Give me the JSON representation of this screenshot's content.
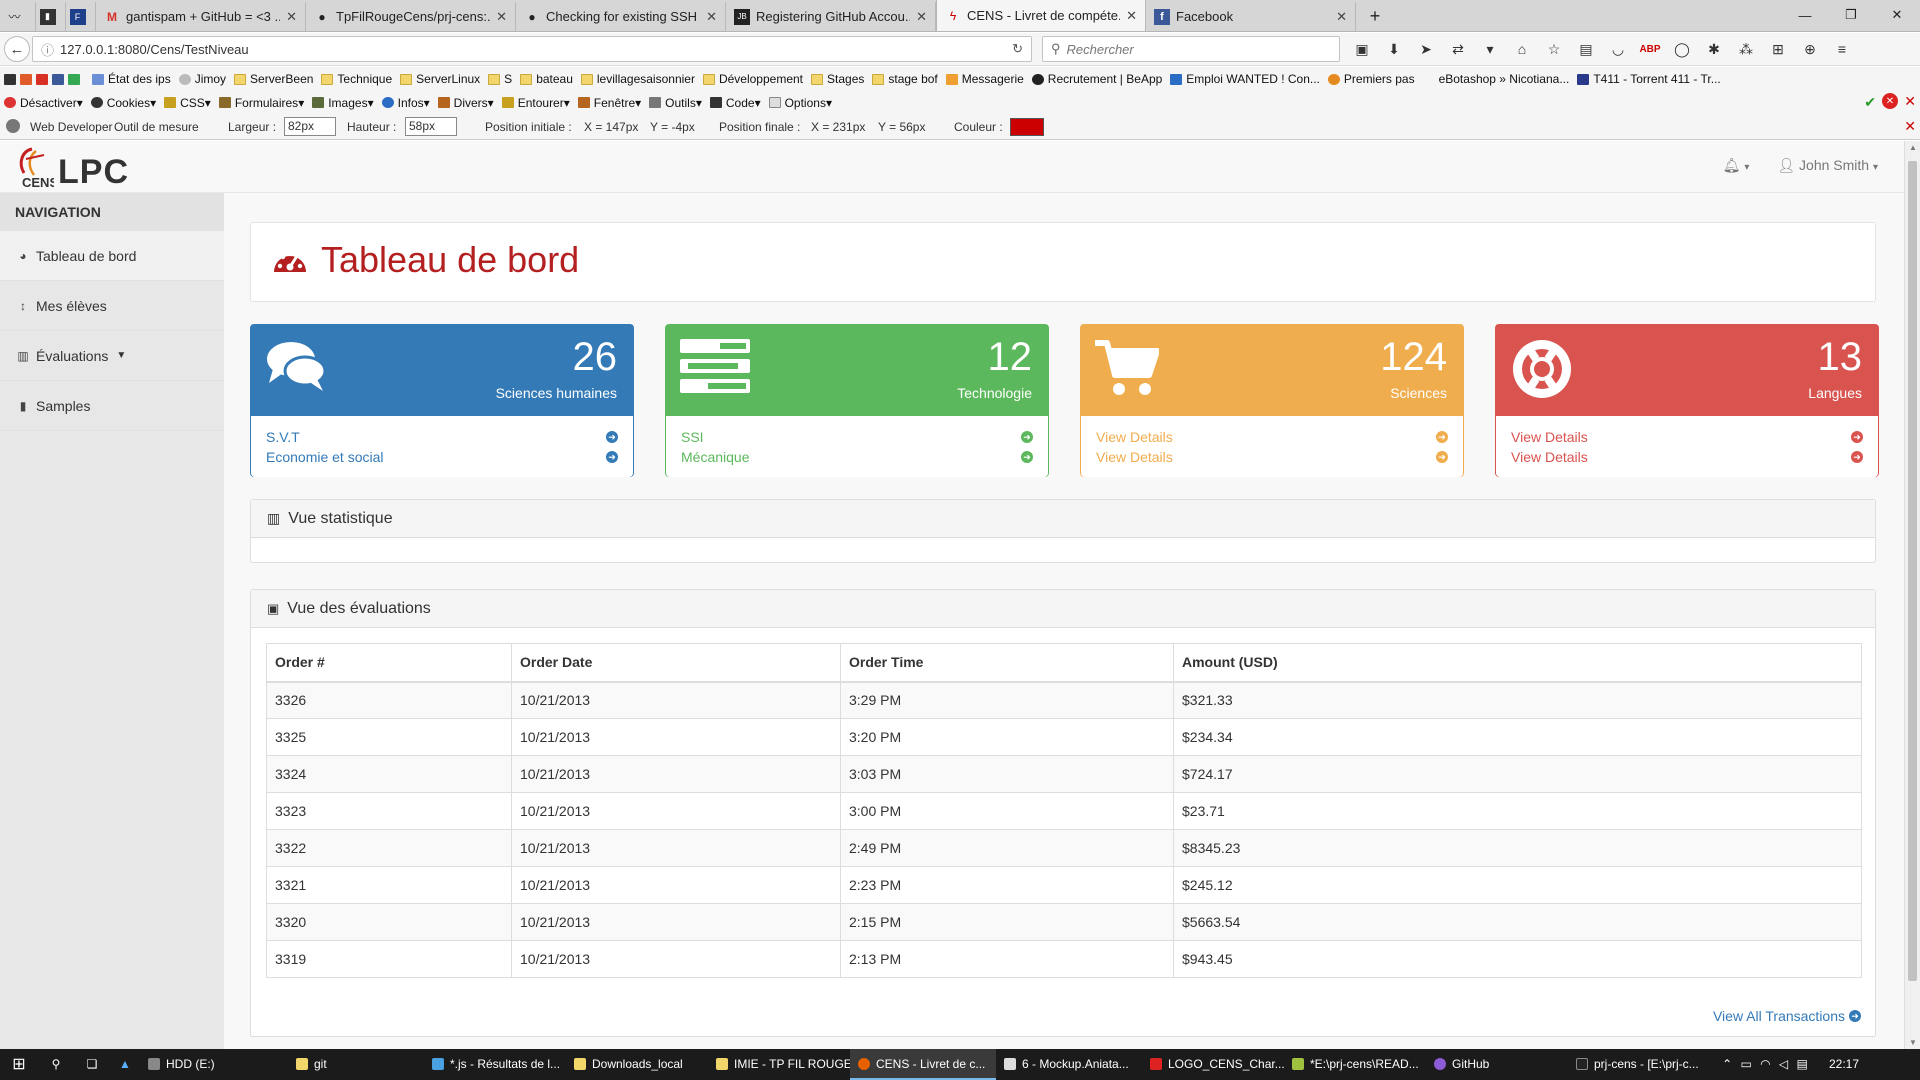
{
  "browser": {
    "tabs": [
      {
        "title": "",
        "icon": "pulse-icon"
      },
      {
        "title": "",
        "icon": "bookmark-dark-icon"
      },
      {
        "title": "",
        "icon": "flag-blue-icon"
      },
      {
        "title": "gantispam + GitHub = <3 ...",
        "icon": "gmail-icon"
      },
      {
        "title": "TpFilRougeCens/prj-cens:...",
        "icon": "github-icon"
      },
      {
        "title": "Checking for existing SSH ...",
        "icon": "github-icon"
      },
      {
        "title": "Registering GitHub Accou...",
        "icon": "jb-icon"
      },
      {
        "title": "CENS - Livret de compéte...",
        "icon": "cens-icon"
      },
      {
        "title": "Facebook",
        "icon": "facebook-icon"
      }
    ],
    "new_tab": "+",
    "url": "127.0.0.1:8080/Cens/TestNiveau",
    "search_placeholder": "Rechercher",
    "bookmarks": [
      "État des ips",
      "Jimoy",
      "ServerBeen",
      "Technique",
      "ServerLinux",
      "S",
      "bateau",
      "levillagesaisonnier",
      "Développement",
      "Stages",
      "stage bof",
      "Messagerie",
      "Recrutement | BeApp",
      "Emploi WANTED ! Con...",
      "Premiers pas",
      "eBotashop » Nicotiana...",
      "T411 - Torrent 411 - Tr..."
    ],
    "webdev_menu": [
      "Désactiver",
      "Cookies",
      "CSS",
      "Formulaires",
      "Images",
      "Infos",
      "Divers",
      "Entourer",
      "Fenêtre",
      "Outils",
      "Code",
      "Options"
    ],
    "measure": {
      "title": "Web Developer",
      "tool": "Outil de mesure",
      "width_label": "Largeur :",
      "width_value": "82px",
      "height_label": "Hauteur :",
      "height_value": "58px",
      "initial_label": "Position initiale :",
      "initial_x": "X = 147px",
      "initial_y": "Y = -4px",
      "final_label": "Position finale :",
      "final_x": "X = 231px",
      "final_y": "Y = 56px",
      "color_label": "Couleur :",
      "color_value": "#cc0000"
    }
  },
  "app": {
    "logo_small": "CENS",
    "logo_text": "LPC",
    "user": "John Smith",
    "nav_header": "NAVIGATION",
    "nav_items": [
      {
        "label": "Tableau de bord",
        "icon": "dashboard-icon"
      },
      {
        "label": "Mes élèves",
        "icon": "sort-icon"
      },
      {
        "label": "Évaluations",
        "icon": "bar-chart-icon"
      },
      {
        "label": "Samples",
        "icon": "file-icon"
      }
    ],
    "page_title": "Tableau de bord",
    "stats": [
      {
        "count": "26",
        "label": "Sciences humaines",
        "links": [
          "S.V.T",
          "Economie et social"
        ],
        "color": "#337ab7",
        "icon": "comments-icon"
      },
      {
        "count": "12",
        "label": "Technologie",
        "links": [
          "SSI",
          "Mécanique"
        ],
        "color": "#5cb85c",
        "icon": "tasks-icon"
      },
      {
        "count": "124",
        "label": "Sciences",
        "links": [
          "View Details",
          "View Details"
        ],
        "color": "#f0ad4e",
        "icon": "shopping-cart-icon"
      },
      {
        "count": "13",
        "label": "Langues",
        "links": [
          "View Details",
          "View Details"
        ],
        "color": "#d9534f",
        "icon": "support-icon"
      }
    ],
    "stats_panel_title": "Vue statistique",
    "eval_panel_title": "Vue des évaluations",
    "table": {
      "headers": [
        "Order #",
        "Order Date",
        "Order Time",
        "Amount (USD)"
      ],
      "rows": [
        [
          "3326",
          "10/21/2013",
          "3:29 PM",
          "$321.33"
        ],
        [
          "3325",
          "10/21/2013",
          "3:20 PM",
          "$234.34"
        ],
        [
          "3324",
          "10/21/2013",
          "3:03 PM",
          "$724.17"
        ],
        [
          "3323",
          "10/21/2013",
          "3:00 PM",
          "$23.71"
        ],
        [
          "3322",
          "10/21/2013",
          "2:49 PM",
          "$8345.23"
        ],
        [
          "3321",
          "10/21/2013",
          "2:23 PM",
          "$245.12"
        ],
        [
          "3320",
          "10/21/2013",
          "2:15 PM",
          "$5663.54"
        ],
        [
          "3319",
          "10/21/2013",
          "2:13 PM",
          "$943.45"
        ]
      ]
    },
    "view_all": "View All Transactions"
  },
  "taskbar": {
    "items": [
      "HDD (E:)",
      "git",
      "*.js - Résultats de l...",
      "Downloads_local",
      "IMIE - TP FIL ROUGE",
      "CENS - Livret de c...",
      "6 - Mockup.Aniata...",
      "LOGO_CENS_Char...",
      "*E:\\prj-cens\\READ...",
      "GitHub",
      "prj-cens - [E:\\prj-c..."
    ],
    "clock": "22:17"
  }
}
